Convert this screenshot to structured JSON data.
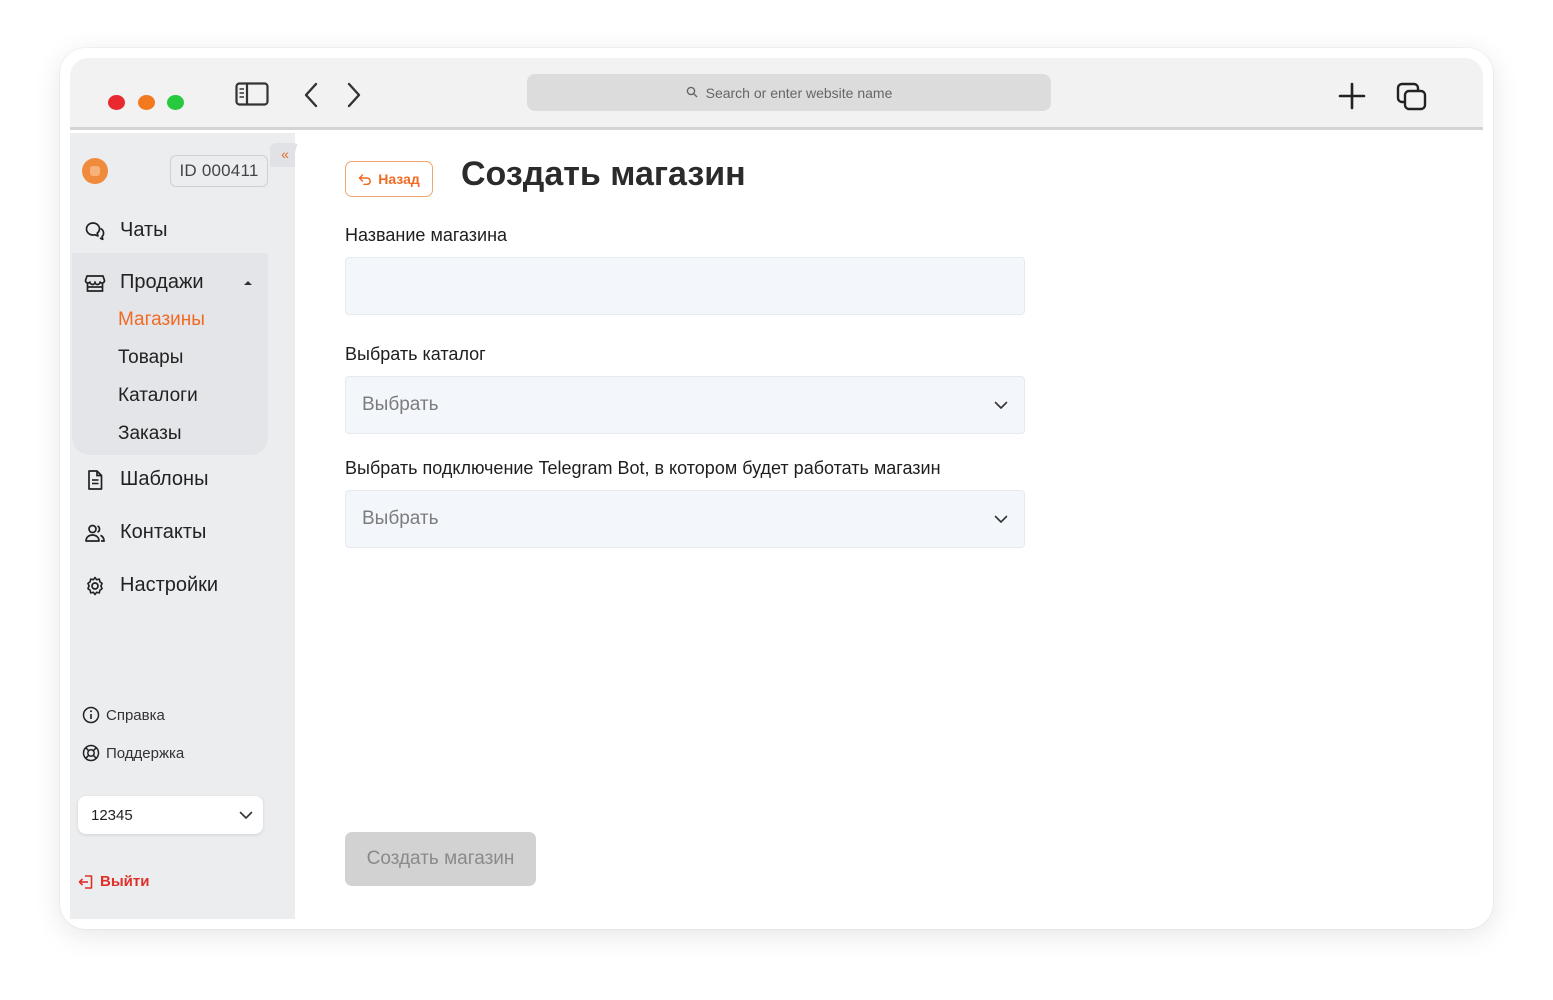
{
  "browser": {
    "url_placeholder": "Search or enter website name"
  },
  "sidebar": {
    "user_id": "ID 000411",
    "nav": {
      "chats": "Чаты",
      "sales": "Продажи",
      "templates": "Шаблоны",
      "contacts": "Контакты",
      "settings": "Настройки"
    },
    "sales_items": [
      "Магазины",
      "Товары",
      "Каталоги",
      "Заказы"
    ],
    "active_sales_item": "Магазины",
    "help": "Справка",
    "support": "Поддержка",
    "account_select": "12345",
    "logout": "Выйти"
  },
  "main": {
    "back_label": "Назад",
    "title": "Создать магазин",
    "store_name_label": "Название магазина",
    "store_name_value": "",
    "catalog_label": "Выбрать каталог",
    "catalog_placeholder": "Выбрать",
    "bot_label": "Выбрать подключение Telegram Bot, в котором будет работать магазин",
    "bot_placeholder": "Выбрать",
    "submit_label": "Создать магазин"
  },
  "colors": {
    "accent": "#f06a24",
    "logout": "#e0302a",
    "sidebar_bg": "#ecedef",
    "input_bg": "#f3f7fb",
    "submit_disabled_bg": "#d2d2d2"
  }
}
